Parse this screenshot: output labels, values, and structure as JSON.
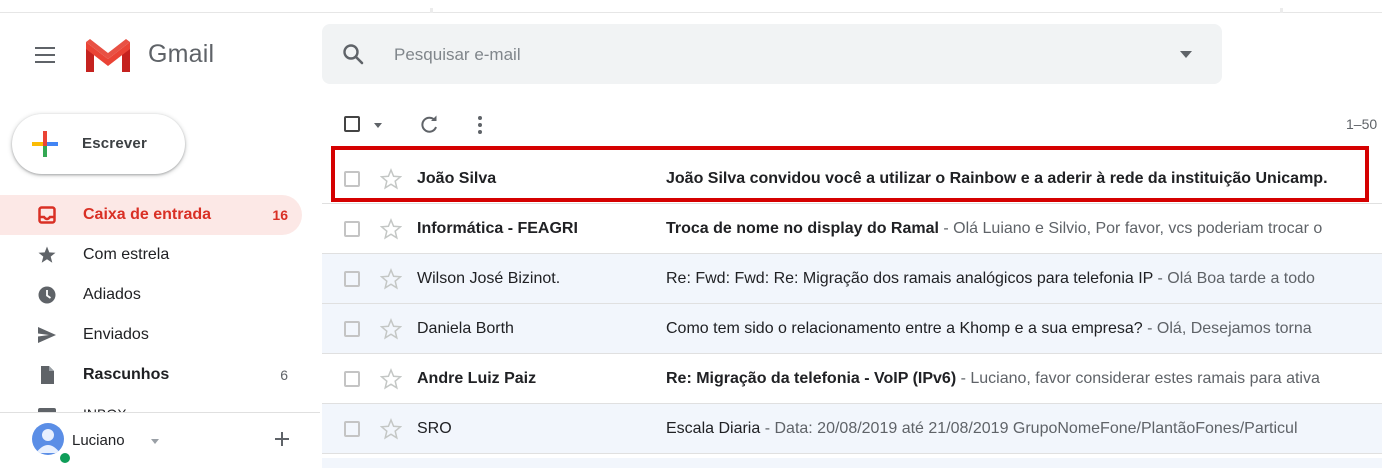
{
  "header": {
    "app_name": "Gmail",
    "menu_icon": "hamburger-menu-icon",
    "logo_icon": "gmail-m-logo-icon",
    "search": {
      "placeholder": "Pesquisar e-mail",
      "icon": "search-icon",
      "options_icon": "caret-down-icon"
    }
  },
  "sidebar": {
    "compose_label": "Escrever",
    "items": [
      {
        "label": "Caixa de entrada",
        "count": "16",
        "icon": "inbox-icon",
        "active": true
      },
      {
        "label": "Com estrela",
        "count": "",
        "icon": "star-filled-icon"
      },
      {
        "label": "Adiados",
        "count": "",
        "icon": "clock-icon"
      },
      {
        "label": "Enviados",
        "count": "",
        "icon": "send-icon"
      },
      {
        "label": "Rascunhos",
        "count": "6",
        "icon": "draft-icon"
      },
      {
        "label": "INBOX",
        "count": "",
        "icon": "label-icon"
      }
    ],
    "account": {
      "name": "Luciano",
      "status": "online"
    }
  },
  "toolbar": {
    "page_range": "1–50"
  },
  "emails": [
    {
      "sender": "João Silva",
      "subject": "João Silva convidou você a utilizar o Rainbow e a aderir à rede da instituição Unicamp.",
      "snippet": "",
      "unread": true
    },
    {
      "sender": "Informática - FEAGRI",
      "subject": "Troca de nome no display do Ramal",
      "snippet": " - Olá Luiano e Silvio, Por favor, vcs poderiam trocar o",
      "unread": true
    },
    {
      "sender": "Wilson José Bizinot.",
      "subject": "Re: Fwd: Fwd: Re: Migração dos ramais analógicos para telefonia IP",
      "snippet": " - Olá Boa tarde a todo",
      "unread": false
    },
    {
      "sender": "Daniela Borth",
      "subject": "Como tem sido o relacionamento entre a Khomp e a sua empresa?",
      "snippet": " - Olá, Desejamos torna",
      "unread": false
    },
    {
      "sender": "Andre Luiz Paiz",
      "subject": "Re: Migração da telefonia - VoIP (IPv6)",
      "snippet": " - Luciano, favor considerar estes ramais para ativa",
      "unread": true
    },
    {
      "sender": "SRO",
      "subject": "Escala Diaria",
      "snippet": " - Data: 20/08/2019 até 21/08/2019 GrupoNomeFone/PlantãoFones/Particul",
      "unread": false
    }
  ],
  "colors": {
    "brand_red": "#d93025",
    "highlight_border": "#d50000",
    "read_row_bg": "#f2f6fc",
    "active_nav_bg": "#fce8e6"
  }
}
